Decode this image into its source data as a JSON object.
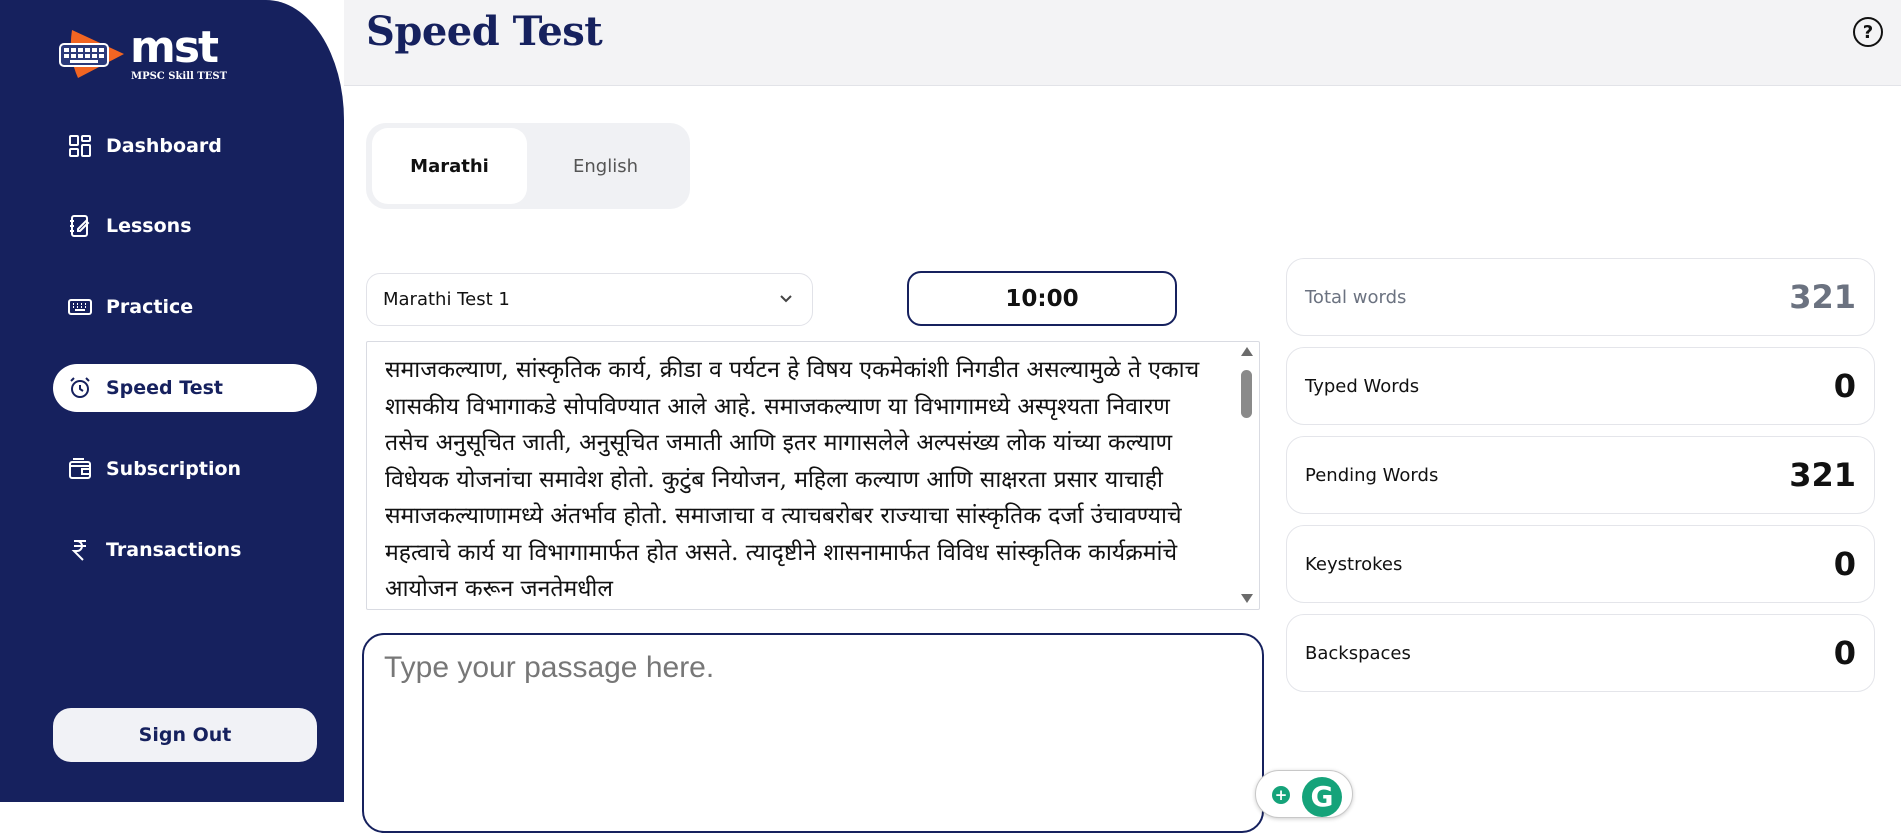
{
  "brand": {
    "name": "mst",
    "tagline": "MPSC Skill TEST"
  },
  "sidebar": {
    "items": [
      {
        "label": "Dashboard",
        "icon": "dashboard-icon",
        "active": false
      },
      {
        "label": "Lessons",
        "icon": "notebook-icon",
        "active": false
      },
      {
        "label": "Practice",
        "icon": "keyboard-icon",
        "active": false
      },
      {
        "label": "Speed Test",
        "icon": "alarm-clock-icon",
        "active": true
      },
      {
        "label": "Subscription",
        "icon": "wallet-icon",
        "active": false
      },
      {
        "label": "Transactions",
        "icon": "rupee-icon",
        "active": false
      }
    ],
    "sign_out": "Sign Out"
  },
  "header": {
    "title": "Speed Test",
    "help_label": "?"
  },
  "language": {
    "tabs": [
      "Marathi",
      "English"
    ],
    "selected": "Marathi"
  },
  "test_select": {
    "value": "Marathi Test 1"
  },
  "timer": {
    "value": "10:00"
  },
  "passage": {
    "text": "समाजकल्याण, सांस्कृतिक कार्य, क्रीडा व पर्यटन हे विषय एकमेकांशी निगडीत असल्यामुळे ते एकाच शासकीय विभागाकडे सोपविण्यात आले आहे. समाजकल्याण या विभागामध्ये अस्पृश्यता निवारण तसेच अनुसूचित जाती, अनुसूचित जमाती आणि इतर मागासलेले अल्पसंख्य लोक यांच्या कल्याण विधेयक योजनांचा समावेश होतो. कुटुंब नियोजन, महिला कल्याण आणि साक्षरता प्रसार याचाही समाजकल्याणामध्ये अंतर्भाव होतो. समाजाचा व त्याचबरोबर राज्याचा सांस्कृतिक दर्जा उंचावण्याचे महत्वाचे कार्य या विभागामार्फत होत असते. त्यादृष्टीने शासनामार्फत विविध सांस्कृतिक कार्यक्रमांचे आयोजन करून जनतेमधील"
  },
  "typing": {
    "value": "",
    "placeholder": "Type your passage here."
  },
  "stats": [
    {
      "label": "Total words",
      "value": "321"
    },
    {
      "label": "Typed Words",
      "value": "0"
    },
    {
      "label": "Pending Words",
      "value": "321"
    },
    {
      "label": "Keystrokes",
      "value": "0"
    },
    {
      "label": "Backspaces",
      "value": "0"
    }
  ],
  "colors": {
    "sidebar": "#16215e",
    "accent": "#f26522",
    "grammarly": "#15a37a"
  }
}
